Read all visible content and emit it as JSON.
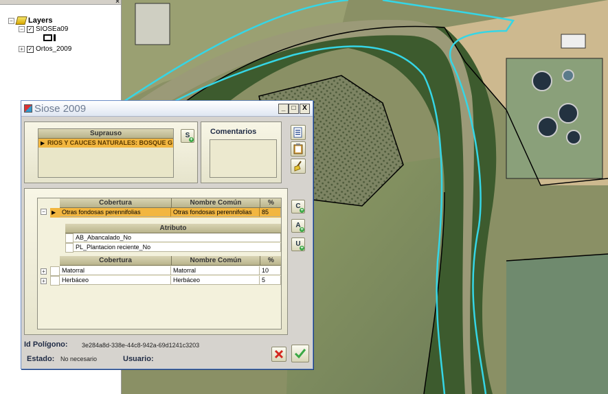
{
  "toc": {
    "root_label": "Layers",
    "layers": [
      {
        "name": "SIOSEa09",
        "checked": true,
        "expanded": true
      },
      {
        "name": "Ortos_2009",
        "checked": true,
        "expanded": false
      }
    ]
  },
  "dialog": {
    "title": "Siose 2009",
    "minimize": "_",
    "maximize": "□",
    "close": "X",
    "suprauso": {
      "header": "Suprauso",
      "rows": [
        "RIOS Y CAUCES NATURALES: BOSQUE G"
      ],
      "button": "S"
    },
    "comentarios": {
      "label": "Comentarios",
      "value": ""
    },
    "coberturas": {
      "headers": [
        "Cobertura",
        "Nombre Común",
        "%"
      ],
      "selected": {
        "cobertura": "Otras fondosas perennifolias",
        "nombre": "Otras fondosas perennifolias",
        "pct": "85"
      },
      "atributo_header": "Atributo",
      "atributos": [
        "AB_Abancalado_No",
        "PL_Plantacion reciente_No"
      ],
      "sub_headers": [
        "Cobertura",
        "Nombre Común",
        "%"
      ],
      "rows": [
        {
          "cobertura": "Matorral",
          "nombre": "Matorral",
          "pct": "10"
        },
        {
          "cobertura": "Herbáceo",
          "nombre": "Herbáceo",
          "pct": "5"
        }
      ],
      "buttons": [
        "C",
        "A",
        "U"
      ]
    },
    "footer": {
      "id_label": "Id Polígono:",
      "id_value": "3e284a8d-338e-44c8-942a-69d1241c3203",
      "estado_label": "Estado:",
      "estado_value": "No necesario",
      "usuario_label": "Usuario:",
      "usuario_value": ""
    }
  },
  "colors": {
    "selection": "#f2b640",
    "polygon_highlight": "#35d6e6",
    "title_text": "#6e7c92"
  }
}
